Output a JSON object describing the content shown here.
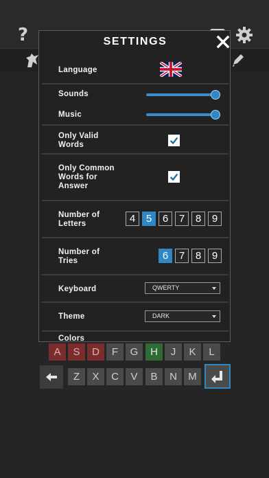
{
  "app": {
    "help_symbol": "?"
  },
  "settings": {
    "title": "SETTINGS",
    "language": {
      "label": "Language",
      "flag_icon": "uk-flag-icon"
    },
    "sounds": {
      "label": "Sounds",
      "level": 1.0
    },
    "music": {
      "label": "Music",
      "level": 1.0
    },
    "only_valid_words": {
      "label_line1": "Only Valid",
      "label_line2": "Words",
      "checked": true
    },
    "only_common_words": {
      "label_line1": "Only Common",
      "label_line2": "Words for",
      "label_line3": "Answer",
      "checked": true
    },
    "number_of_letters": {
      "label_line1": "Number of",
      "label_line2": "Letters",
      "options": [
        "4",
        "5",
        "6",
        "7",
        "8",
        "9"
      ],
      "selected": "5"
    },
    "number_of_tries": {
      "label_line1": "Number of",
      "label_line2": "Tries",
      "options": [
        "6",
        "7",
        "8",
        "9"
      ],
      "selected": "6"
    },
    "keyboard": {
      "label": "Keyboard",
      "value": "QWERTY"
    },
    "theme": {
      "label": "Theme",
      "value": "DARK"
    },
    "colors": {
      "label": "Colors"
    }
  },
  "keyboard": {
    "row2": [
      "A",
      "S",
      "D",
      "F",
      "G",
      "H",
      "J",
      "K",
      "L"
    ],
    "row2_states": [
      "absent",
      "absent",
      "absent",
      "unused",
      "unused",
      "correct",
      "unused",
      "unused",
      "unused"
    ],
    "row3": [
      "Z",
      "X",
      "C",
      "V",
      "B",
      "N",
      "M"
    ],
    "backspace_icon": "backspace-arrow-icon",
    "enter_icon": "enter-icon"
  },
  "colors": {
    "accent": "#2f88c5",
    "absent": "#7a2d2d",
    "correct": "#2f6b35",
    "key": "#4a4a4a",
    "modal_bg": "#222222"
  }
}
